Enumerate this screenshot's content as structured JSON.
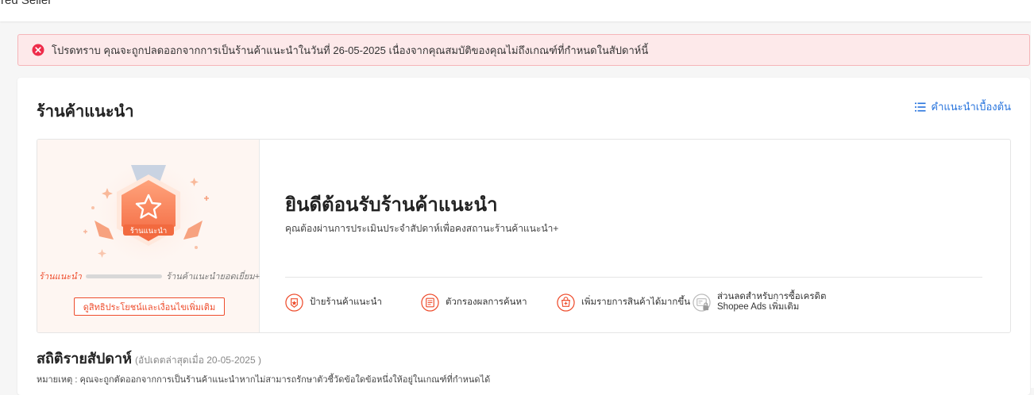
{
  "topbar": {
    "title": "rred Seller"
  },
  "alert": {
    "text": "โปรดทราบ คุณจะถูกปลดออกจากการเป็นร้านค้าแนะนำในวันที่ 26-05-2025 เนื่องจากคุณสมบัติของคุณไม่ถึงเกณฑ์ที่กำหนดในสัปดาห์นี้",
    "icon": "error-circle-icon",
    "color": "#ee2c4a"
  },
  "header": {
    "title": "ร้านค้าแนะนำ",
    "guide_link": "คำแนะนำเบื้องต้น"
  },
  "badge": {
    "label": "ร้านแนะนำ",
    "progress_start": "ร้านแนะนำ",
    "progress_end": "ร้านค้าแนะนำยอดเยี่ยม+",
    "progress_fraction": 0,
    "benefit_button": "ดูสิทธิประโยชน์และเงื่อนไขเพิ่มเติม"
  },
  "welcome": {
    "title": "ยินดีต้อนรับร้านค้าแนะนำ",
    "subtitle": "คุณต้องผ่านการประเมินประจำสัปดาห์เพื่อคงสถานะร้านค้าแนะนำ+"
  },
  "benefits": [
    {
      "label": "ป้ายร้านค้าแนะนำ",
      "icon": "shop-badge-icon",
      "locked": false
    },
    {
      "label": "ตัวกรองผลการค้นหา",
      "icon": "search-filter-icon",
      "locked": false
    },
    {
      "label": "เพิ่มรายการสินค้าได้มากขึ้น",
      "icon": "product-listing-icon",
      "locked": false
    },
    {
      "label": "ส่วนลดสำหรับการซื้อเครดิต Shopee Ads เพิ่มเติม",
      "icon": "ads-credit-icon",
      "locked": true
    }
  ],
  "stats": {
    "title": "สถิติรายสัปดาห์",
    "updated": "(อัปเดตล่าสุดเมื่อ 20-05-2025 )",
    "note": "หมายเหตุ : คุณจะถูกตัดออกจากการเป็นร้านค้าแนะนำหากไม่สามารถรักษาตัวชี้วัดข้อใดข้อหนึ่งให้อยู่ในเกณฑ์ที่กำหนดได้"
  },
  "colors": {
    "accent": "#ee4d2d",
    "link": "#2673dd",
    "alert_bg": "#fde9ea"
  }
}
